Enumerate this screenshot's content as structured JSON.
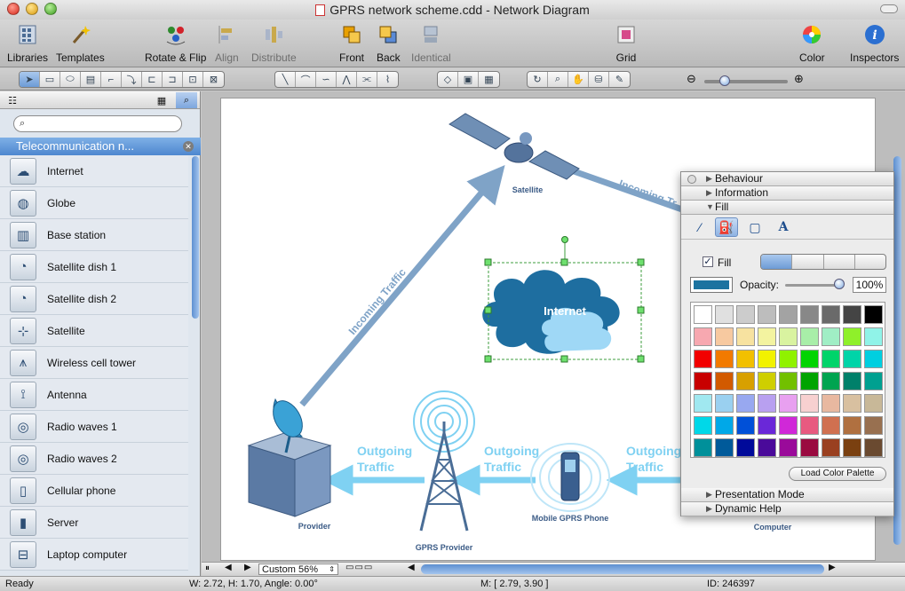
{
  "window": {
    "title": "GPRS network scheme.cdd - Network Diagram"
  },
  "toolbar": {
    "libraries": "Libraries",
    "templates": "Templates",
    "rotate_flip": "Rotate & Flip",
    "align": "Align",
    "distribute": "Distribute",
    "front": "Front",
    "back": "Back",
    "identical": "Identical",
    "grid": "Grid",
    "color": "Color",
    "inspectors": "Inspectors"
  },
  "library": {
    "search_placeholder": "",
    "header": "Telecommunication n...",
    "items": [
      {
        "label": "Internet",
        "icon": "cloud-icon"
      },
      {
        "label": "Globe",
        "icon": "globe-icon"
      },
      {
        "label": "Base station",
        "icon": "base-station-icon"
      },
      {
        "label": "Satellite dish 1",
        "icon": "satellite-dish-icon"
      },
      {
        "label": "Satellite dish 2",
        "icon": "satellite-dish-icon"
      },
      {
        "label": "Satellite",
        "icon": "satellite-icon"
      },
      {
        "label": "Wireless cell tower",
        "icon": "cell-tower-icon"
      },
      {
        "label": "Antenna",
        "icon": "antenna-icon"
      },
      {
        "label": "Radio waves 1",
        "icon": "radio-waves-icon"
      },
      {
        "label": "Radio waves 2",
        "icon": "radio-waves-icon"
      },
      {
        "label": "Cellular phone",
        "icon": "cellular-phone-icon"
      },
      {
        "label": "Server",
        "icon": "server-icon"
      },
      {
        "label": "Laptop computer",
        "icon": "laptop-icon"
      }
    ]
  },
  "diagram": {
    "satellite": "Satellite",
    "internet": "Internet",
    "incoming_left": "Incoming Traffic",
    "incoming_right": "Incoming Tr",
    "outgoing_1": "Outgoing",
    "outgoing_1b": "Traffic",
    "outgoing_2": "Outgoing",
    "outgoing_2b": "Traffic",
    "outgoing_3": "Outgoing",
    "outgoing_3b": "Traffic",
    "provider": "Provider",
    "gprs_provider": "GPRS Provider",
    "mobile_phone": "Mobile GPRS Phone",
    "computer": "Computer"
  },
  "inspector": {
    "behaviour": "Behaviour",
    "information": "Information",
    "fill": "Fill",
    "fill_enabled_label": "Fill",
    "opacity_label": "Opacity:",
    "opacity_value": "100%",
    "opacity_level": 1.0,
    "fill_color": "#1c73a0",
    "load_palette": "Load Color Palette",
    "presentation_mode": "Presentation Mode",
    "dynamic_help": "Dynamic Help",
    "palette": [
      "#ffffff",
      "#e0e0e0",
      "#cccccc",
      "#bdbdbd",
      "#a3a3a3",
      "#888888",
      "#6a6a6a",
      "#444444",
      "#000000",
      "#f7a8b0",
      "#f7c9a0",
      "#f7e2a0",
      "#f3f3a0",
      "#d9f3a0",
      "#a8eea8",
      "#a0eec5",
      "#8ff02a",
      "#90f3e8",
      "#f20000",
      "#f27a00",
      "#f2c000",
      "#f2f200",
      "#90f200",
      "#00d400",
      "#00d46a",
      "#00d4a8",
      "#00cfe0",
      "#c80000",
      "#d25a00",
      "#d8a000",
      "#cfcf00",
      "#72c000",
      "#00a400",
      "#00a450",
      "#00806a",
      "#00a090",
      "#a0e8f0",
      "#9ad0f0",
      "#98a8f0",
      "#b8a0f0",
      "#e8a0f0",
      "#f7d0d0",
      "#e8b8a0",
      "#d8c0a0",
      "#c8b898",
      "#00d8e8",
      "#00a8e8",
      "#0050d8",
      "#6a28d8",
      "#d028d8",
      "#e85a80",
      "#d07050",
      "#b07040",
      "#987050",
      "#00909a",
      "#005a9a",
      "#000a9a",
      "#4a0a9a",
      "#9a0a9a",
      "#9a0a40",
      "#9a4020",
      "#7a4010",
      "#6a4a30"
    ]
  },
  "canvas": {
    "zoom": "Custom 56%"
  },
  "status": {
    "state": "Ready",
    "geometry": "W: 2.72,  H: 1.70,  Angle: 0.00°",
    "mouse": "M: [ 2.79, 3.90 ]",
    "id": "ID: 246397"
  }
}
